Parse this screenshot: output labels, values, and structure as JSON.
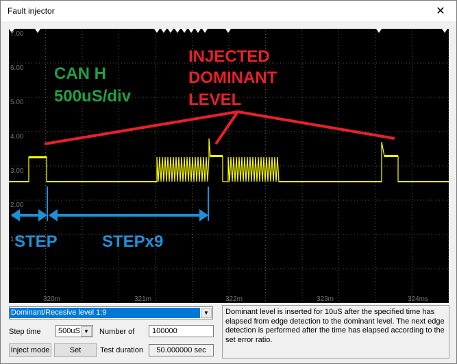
{
  "window": {
    "title": "Fault injector",
    "close_glyph": "✕"
  },
  "scope": {
    "y_ticks": [
      "7.00",
      "6.00",
      "5.00",
      "4.00",
      "3.00",
      "2.00",
      "1.00"
    ],
    "x_ticks": [
      "320m",
      "321m",
      "322m",
      "323m",
      "324ms"
    ],
    "annotations": {
      "channel_line1": "CAN H",
      "channel_line2": "500uS/div",
      "injected_line1": "INJECTED",
      "injected_line2": "DOMINANT",
      "injected_line3": "LEVEL",
      "step": "STEP",
      "step_x9": "STEPx9"
    },
    "colors": {
      "background": "#000000",
      "grid": "#555555",
      "trace": "#ffff00",
      "annotation_green": "#22a040",
      "annotation_red": "#e8202a",
      "annotation_blue": "#1e90d8"
    }
  },
  "controls": {
    "mode_value": "Dominant/Recesive level 1:9",
    "step_time_label": "Step time",
    "step_time_value": "500uS",
    "number_of_label": "Number of",
    "number_of_value": "100000",
    "inject_mode_label": "Inject mode",
    "set_label": "Set",
    "test_duration_label": "Test duration",
    "test_duration_value": "50.000000 sec"
  },
  "description": "Dominant level is inserted for 10uS after the specified time has elapsed from edge detection to the dominant level. The next edge detection is performed after the time has elapsed according to the set error ratio."
}
